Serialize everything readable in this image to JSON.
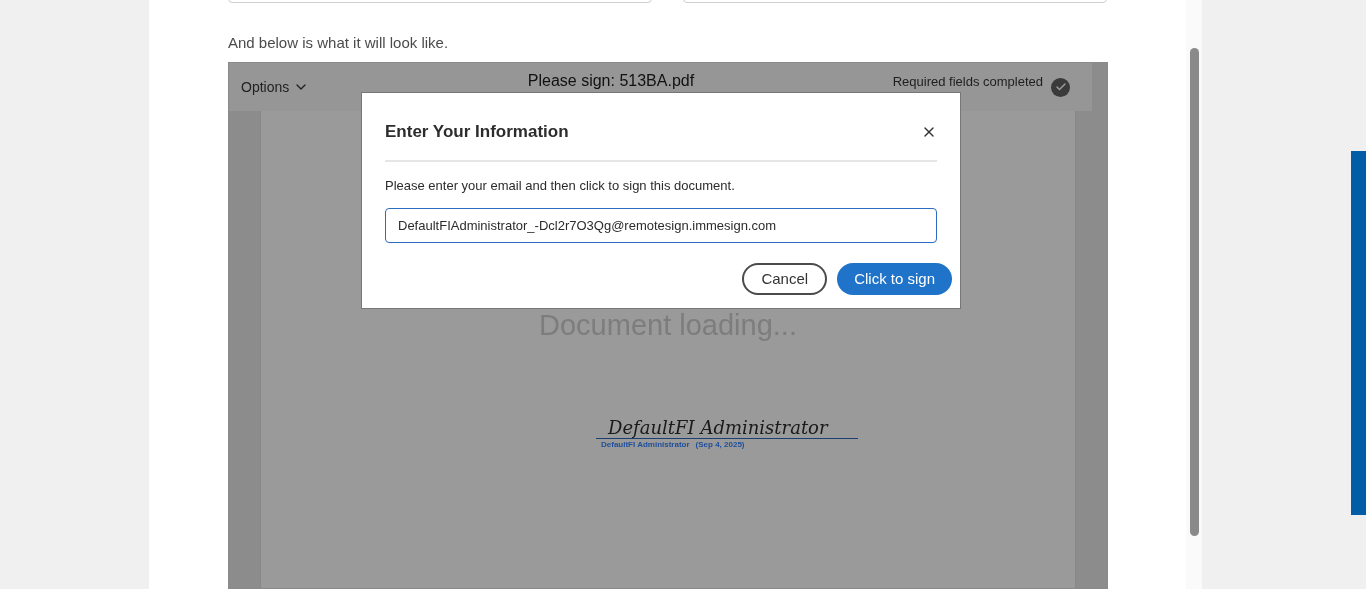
{
  "intro": "And below is what it will look like.",
  "preview": {
    "options_label": "Options",
    "title": "Please sign: 513BA.pdf",
    "status": "Required fields completed",
    "status_done": true,
    "loading_text": "Document loading...",
    "signature": {
      "script": "DefaultFI Administrator",
      "name": "DefaultFI Administrator",
      "date": "(Sep 4, 2025)"
    }
  },
  "dialog": {
    "title": "Enter Your Information",
    "message": "Please enter your email and then click to sign this document.",
    "email": "DefaultFIAdministrator_-Dcl2r7O3Qg@remotesign.immesign.com",
    "buttons": [
      {
        "label": "Cancel",
        "kind": "secondary"
      },
      {
        "label": "Click to sign",
        "kind": "primary"
      }
    ]
  }
}
